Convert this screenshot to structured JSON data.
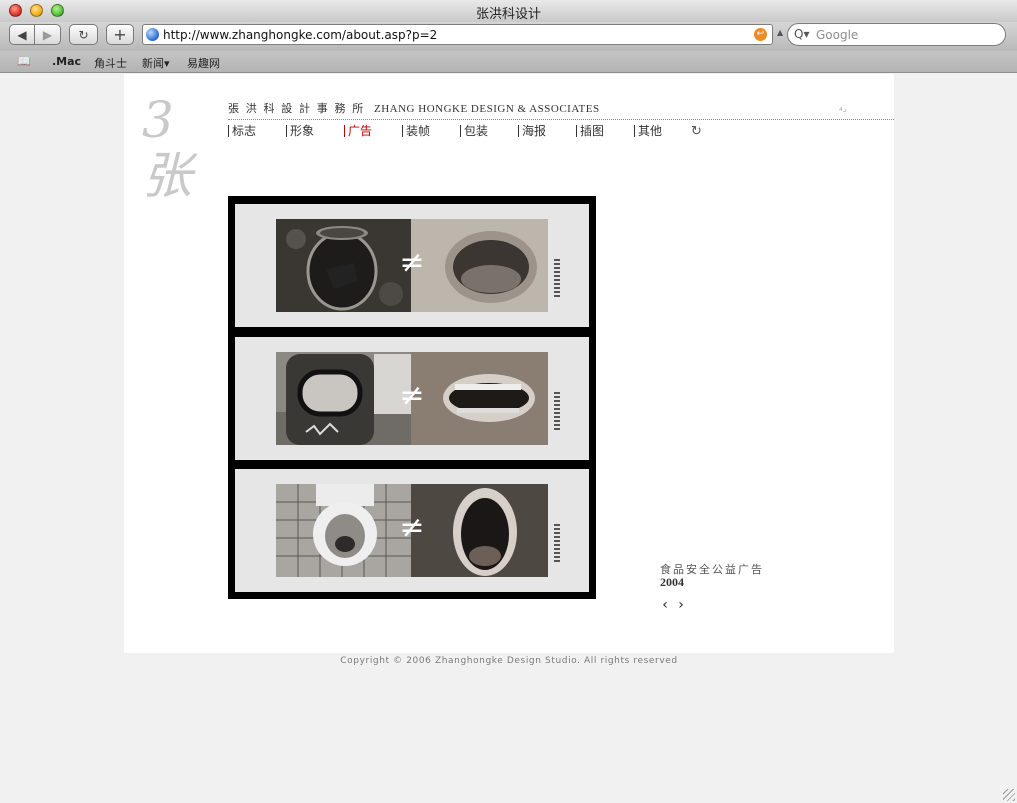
{
  "window": {
    "title": "张洪科设计"
  },
  "toolbar": {
    "back_icon": "◀",
    "forward_icon": "▶",
    "reload_icon": "↻",
    "add_icon": "+",
    "url": "http://www.zhanghongke.com/about.asp?p=2",
    "rss_icon": "↩",
    "search_placeholder": "Google",
    "search_icon": "Q▾"
  },
  "bookmarks": {
    "book_icon": "📖",
    "items": [
      ".Mac",
      "角斗士",
      "新闻▾",
      "易趣网"
    ]
  },
  "site": {
    "logo": "3张",
    "studio_name_cn": "張 洪 科 設 計 事 務 所",
    "studio_name_en": "ZHANG HONGKE DESIGN & ASSOCIATES",
    "corner_mark": "₄⌟",
    "nav": [
      {
        "label": "标志",
        "active": false
      },
      {
        "label": "形象",
        "active": false
      },
      {
        "label": "广告",
        "active": true
      },
      {
        "label": "装帧",
        "active": false
      },
      {
        "label": "包装",
        "active": false
      },
      {
        "label": "海报",
        "active": false
      },
      {
        "label": "插图",
        "active": false
      },
      {
        "label": "其他",
        "active": false
      }
    ],
    "nav_refresh_icon": "↻",
    "artwork": {
      "neq_symbol": "≠"
    },
    "caption": {
      "title": "食品安全公益广告",
      "year": "2004"
    },
    "pager": {
      "prev": "‹",
      "next": "›"
    },
    "copyright": "Copyright © 2006 Zhanghongke Design Studio. All rights reserved"
  },
  "colors": {
    "active_nav": "#c00000",
    "page_bg": "#ffffff",
    "window_bg": "#f1f1f1"
  }
}
